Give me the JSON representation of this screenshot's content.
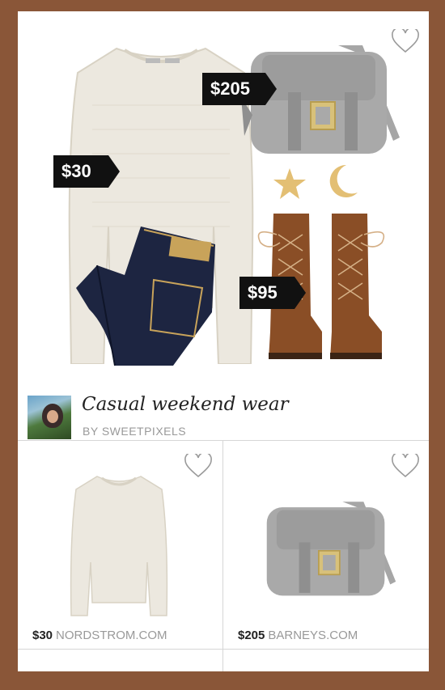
{
  "collection": {
    "title": "Casual weekend wear",
    "byline": "BY SWEETPIXELS",
    "price_tags": {
      "bag": "$205",
      "sweater": "$30",
      "boots": "$95"
    }
  },
  "products": [
    {
      "price": "$30",
      "store": "NORDSTROM.COM"
    },
    {
      "price": "$205",
      "store": "BARNEYS.COM"
    }
  ],
  "colors": {
    "background": "#8a5638",
    "card": "#ffffff",
    "tag": "#111111",
    "muted_text": "#999999"
  }
}
